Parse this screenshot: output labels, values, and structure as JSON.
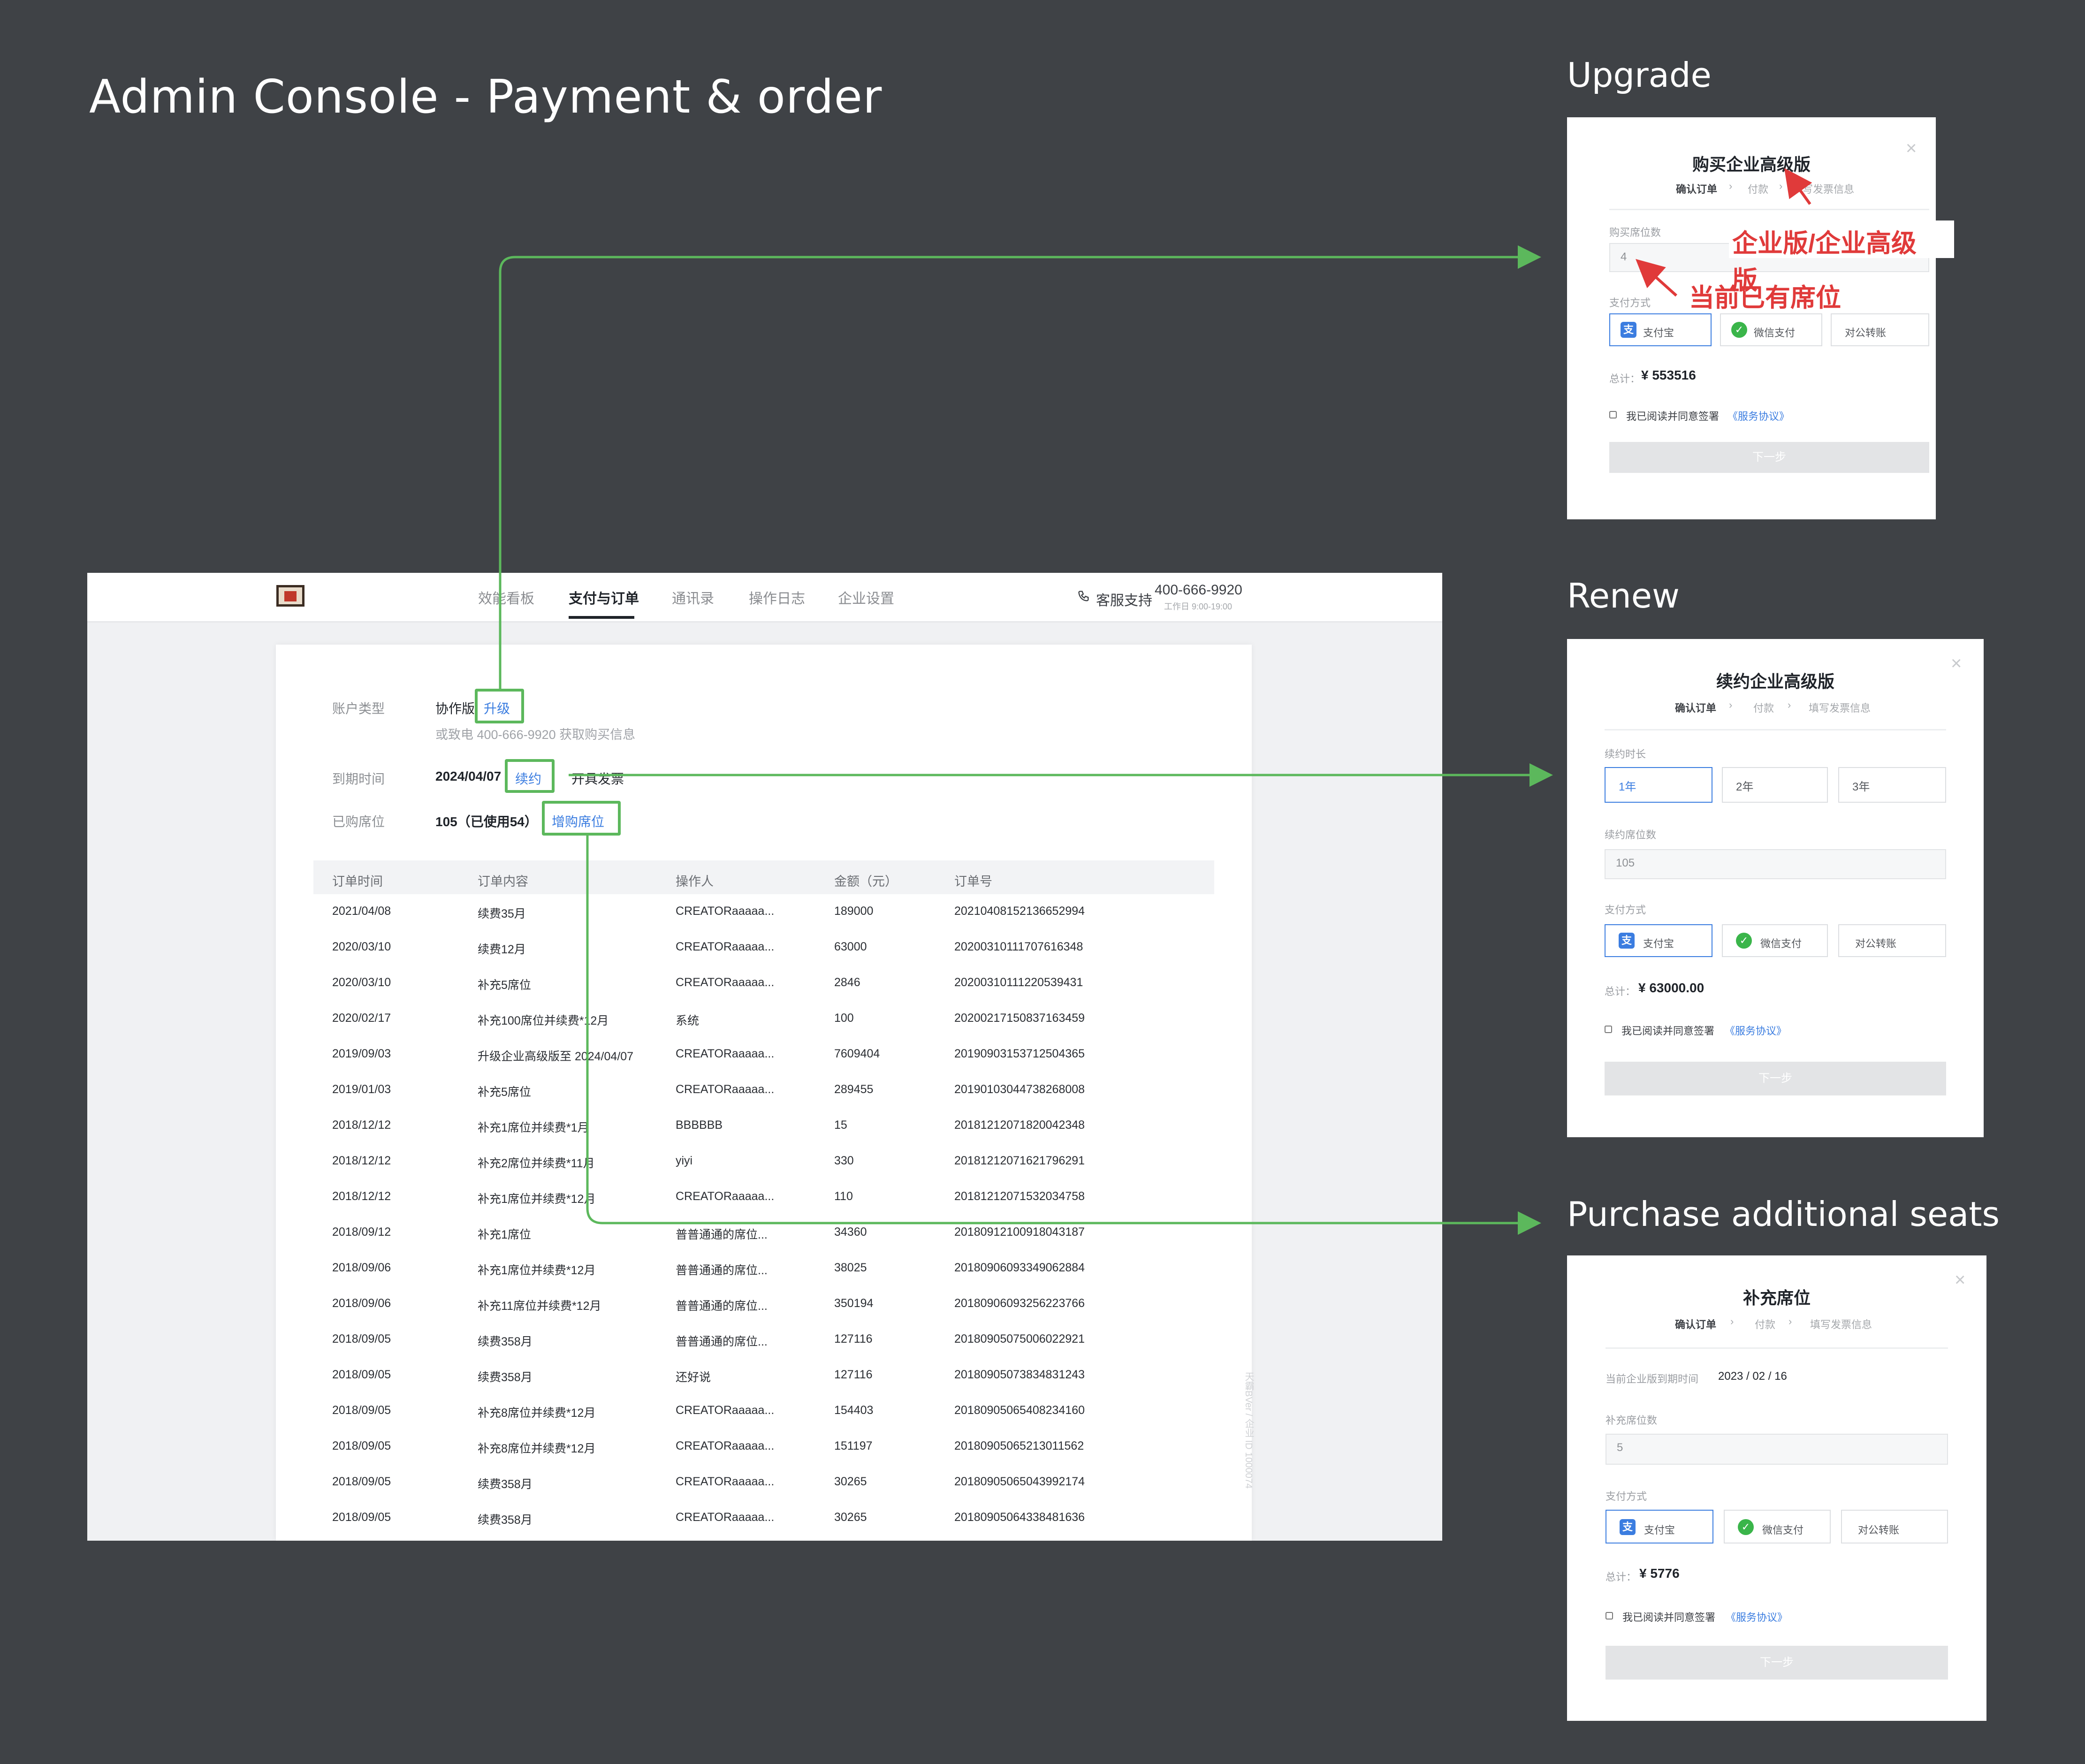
{
  "main_title": "Admin Console - Payment & order",
  "sections": {
    "upgrade": "Upgrade",
    "renew": "Renew",
    "purchase": "Purchase additional seats"
  },
  "nav": {
    "items": [
      "效能看板",
      "支付与订单",
      "通讯录",
      "操作日志",
      "企业设置"
    ],
    "active": "支付与订单",
    "support_label": "客服支持",
    "support_phone": "400-666-9920",
    "support_hours": "工作日 9:00-19:00"
  },
  "account": {
    "type_label": "账户类型",
    "type_value": "协作版",
    "upgrade_link": "升级",
    "contact_hint": "或致电 400-666-9920 获取购买信息",
    "expiry_label": "到期时间",
    "expiry_value": "2024/04/07",
    "renew_link": "续约",
    "invoice_link": "开具发票",
    "seats_label": "已购席位",
    "seats_value": "105（已使用54）",
    "add_seats_link": "增购席位"
  },
  "watermark": "天霸BVer / 企业 ID 1000074",
  "orders": {
    "headers": [
      "订单时间",
      "订单内容",
      "操作人",
      "金额（元）",
      "订单号"
    ],
    "rows": [
      [
        "2021/04/08",
        "续费35月",
        "CREATORaaaaa...",
        "189000",
        "20210408152136652994"
      ],
      [
        "2020/03/10",
        "续费12月",
        "CREATORaaaaa...",
        "63000",
        "20200310111707616348"
      ],
      [
        "2020/03/10",
        "补充5席位",
        "CREATORaaaaa...",
        "2846",
        "20200310111220539431"
      ],
      [
        "2020/02/17",
        "补充100席位并续费*12月",
        "系统",
        "100",
        "20200217150837163459"
      ],
      [
        "2019/09/03",
        "升级企业高级版至 2024/04/07",
        "CREATORaaaaa...",
        "7609404",
        "20190903153712504365"
      ],
      [
        "2019/01/03",
        "补充5席位",
        "CREATORaaaaa...",
        "289455",
        "20190103044738268008"
      ],
      [
        "2018/12/12",
        "补充1席位并续费*1月",
        "BBBBBB",
        "15",
        "20181212071820042348"
      ],
      [
        "2018/12/12",
        "补充2席位并续费*11月",
        "yiyi",
        "330",
        "20181212071621796291"
      ],
      [
        "2018/12/12",
        "补充1席位并续费*12月",
        "CREATORaaaaa...",
        "110",
        "20181212071532034758"
      ],
      [
        "2018/09/12",
        "补充1席位",
        "普普通通的席位...",
        "34360",
        "20180912100918043187"
      ],
      [
        "2018/09/06",
        "补充1席位并续费*12月",
        "普普通通的席位...",
        "38025",
        "20180906093349062884"
      ],
      [
        "2018/09/06",
        "补充11席位并续费*12月",
        "普普通通的席位...",
        "350194",
        "20180906093256223766"
      ],
      [
        "2018/09/05",
        "续费358月",
        "普普通通的席位...",
        "127116",
        "20180905075006022921"
      ],
      [
        "2018/09/05",
        "续费358月",
        "还好说",
        "127116",
        "20180905073834831243"
      ],
      [
        "2018/09/05",
        "补充8席位并续费*12月",
        "CREATORaaaaa...",
        "154403",
        "20180905065408234160"
      ],
      [
        "2018/09/05",
        "补充8席位并续费*12月",
        "CREATORaaaaa...",
        "151197",
        "20180905065213011562"
      ],
      [
        "2018/09/05",
        "续费358月",
        "CREATORaaaaa...",
        "30265",
        "20180905065043992174"
      ],
      [
        "2018/09/05",
        "续费358月",
        "CREATORaaaaa...",
        "30265",
        "20180905064338481636"
      ]
    ]
  },
  "modal_upgrade": {
    "title": "购买企业高级版",
    "steps": [
      "确认订单",
      "付款",
      "填写发票信息"
    ],
    "seats_label": "购买席位数",
    "seats_value": "4",
    "pay_label": "支付方式",
    "pay_options": [
      "支付宝",
      "微信支付",
      "对公转账"
    ],
    "total_label": "总计：",
    "total_value": "¥ 553516",
    "agree_text": "我已阅读并同意签署",
    "agree_link": "《服务协议》",
    "next": "下一步",
    "note_edition": "企业版/企业高级版",
    "note_seats": "当前已有席位"
  },
  "modal_renew": {
    "title": "续约企业高级版",
    "steps": [
      "确认订单",
      "付款",
      "填写发票信息"
    ],
    "duration_label": "续约时长",
    "durations": [
      "1年",
      "2年",
      "3年"
    ],
    "seats_label": "续约席位数",
    "seats_value": "105",
    "pay_label": "支付方式",
    "pay_options": [
      "支付宝",
      "微信支付",
      "对公转账"
    ],
    "total_label": "总计：",
    "total_value": "¥ 63000.00",
    "agree_text": "我已阅读并同意签署",
    "agree_link": "《服务协议》",
    "next": "下一步"
  },
  "modal_seats": {
    "title": "补充席位",
    "steps": [
      "确认订单",
      "付款",
      "填写发票信息"
    ],
    "expiry_label": "当前企业版到期时间",
    "expiry_value": "2023 / 02 / 16",
    "seats_label": "补充席位数",
    "seats_value": "5",
    "pay_label": "支付方式",
    "pay_options": [
      "支付宝",
      "微信支付",
      "对公转账"
    ],
    "total_label": "总计：",
    "total_value": "¥ 5776",
    "agree_text": "我已阅读并同意签署",
    "agree_link": "《服务协议》",
    "next": "下一步"
  },
  "colors": {
    "background": "#3f4246",
    "accent": "#3b7de0",
    "connector": "#5cb85c",
    "annotation": "#e03a3a"
  }
}
